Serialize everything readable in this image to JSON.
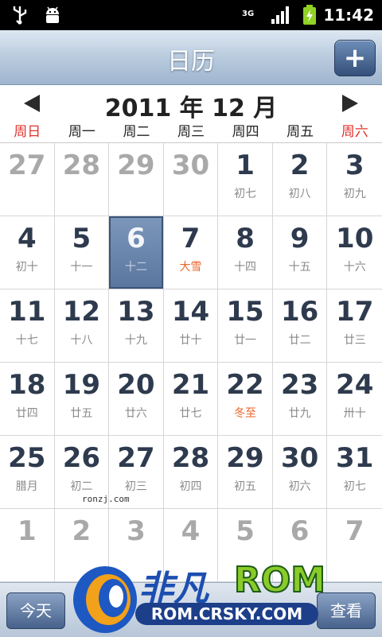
{
  "status_bar": {
    "time": "11:42",
    "network_type": "3G",
    "icons": [
      "usb-icon",
      "android-debug-icon",
      "network-3g-icon",
      "signal-icon",
      "battery-charging-icon"
    ]
  },
  "header": {
    "title": "日历",
    "add_button_icon": "plus-icon"
  },
  "month_header": {
    "title": "2011 年 12 月"
  },
  "weekdays": [
    "周日",
    "周一",
    "周二",
    "周三",
    "周四",
    "周五",
    "周六"
  ],
  "calendar": {
    "selected_day": "6",
    "cells": [
      {
        "day": "27",
        "lunar": "",
        "other": true
      },
      {
        "day": "28",
        "lunar": "",
        "other": true
      },
      {
        "day": "29",
        "lunar": "",
        "other": true
      },
      {
        "day": "30",
        "lunar": "",
        "other": true
      },
      {
        "day": "1",
        "lunar": "初七"
      },
      {
        "day": "2",
        "lunar": "初八"
      },
      {
        "day": "3",
        "lunar": "初九"
      },
      {
        "day": "4",
        "lunar": "初十"
      },
      {
        "day": "5",
        "lunar": "十一"
      },
      {
        "day": "6",
        "lunar": "十二",
        "selected": true
      },
      {
        "day": "7",
        "lunar": "大雪",
        "term": true
      },
      {
        "day": "8",
        "lunar": "十四"
      },
      {
        "day": "9",
        "lunar": "十五"
      },
      {
        "day": "10",
        "lunar": "十六"
      },
      {
        "day": "11",
        "lunar": "十七"
      },
      {
        "day": "12",
        "lunar": "十八"
      },
      {
        "day": "13",
        "lunar": "十九"
      },
      {
        "day": "14",
        "lunar": "廿十"
      },
      {
        "day": "15",
        "lunar": "廿一"
      },
      {
        "day": "16",
        "lunar": "廿二"
      },
      {
        "day": "17",
        "lunar": "廿三"
      },
      {
        "day": "18",
        "lunar": "廿四"
      },
      {
        "day": "19",
        "lunar": "廿五"
      },
      {
        "day": "20",
        "lunar": "廿六"
      },
      {
        "day": "21",
        "lunar": "廿七"
      },
      {
        "day": "22",
        "lunar": "冬至",
        "term": true
      },
      {
        "day": "23",
        "lunar": "廿九"
      },
      {
        "day": "24",
        "lunar": "卅十"
      },
      {
        "day": "25",
        "lunar": "腊月"
      },
      {
        "day": "26",
        "lunar": "初二"
      },
      {
        "day": "27",
        "lunar": "初三"
      },
      {
        "day": "28",
        "lunar": "初四"
      },
      {
        "day": "29",
        "lunar": "初五"
      },
      {
        "day": "30",
        "lunar": "初六"
      },
      {
        "day": "31",
        "lunar": "初七"
      },
      {
        "day": "1",
        "lunar": "",
        "other": true
      },
      {
        "day": "2",
        "lunar": "",
        "other": true
      },
      {
        "day": "3",
        "lunar": "",
        "other": true
      },
      {
        "day": "4",
        "lunar": "",
        "other": true
      },
      {
        "day": "5",
        "lunar": "",
        "other": true
      },
      {
        "day": "6",
        "lunar": "",
        "other": true
      },
      {
        "day": "7",
        "lunar": "",
        "other": true
      }
    ]
  },
  "watermark": {
    "small_text": "ronzj.com",
    "logo_cn": "非凡",
    "logo_en": "ROM",
    "logo_url": "ROM.CRSKY.COM"
  },
  "bottom_bar": {
    "today_label": "今天",
    "view_label": "查看"
  },
  "colors": {
    "weekend_header": "#e0322b",
    "solar_term": "#e8652a",
    "selected_cell": "#6a86ad",
    "day_number": "#2e3a4d"
  }
}
